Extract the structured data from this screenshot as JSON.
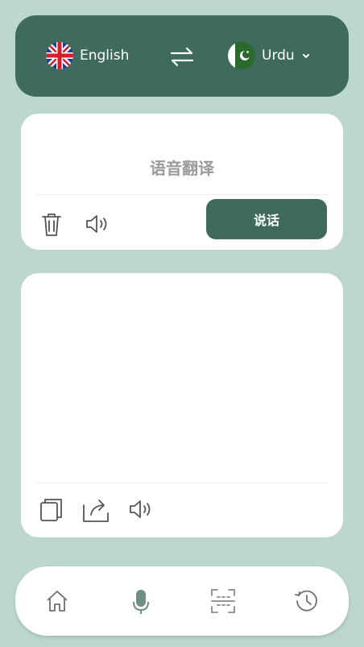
{
  "languages": {
    "source": {
      "label": "English",
      "flag": "uk-flag-icon"
    },
    "target": {
      "label": "Urdu",
      "flag": "pakistan-flag-icon"
    }
  },
  "input": {
    "placeholder": "语音翻译",
    "speak_button": "说话"
  },
  "colors": {
    "accent": "#3e6b5e",
    "background": "#bcd7d0",
    "card": "#ffffff",
    "placeholder_text": "#9a9a9a"
  },
  "nav": {
    "items": [
      {
        "name": "home",
        "icon": "home-icon"
      },
      {
        "name": "voice",
        "icon": "microphone-icon"
      },
      {
        "name": "scan",
        "icon": "scan-icon"
      },
      {
        "name": "history",
        "icon": "history-icon"
      }
    ]
  }
}
